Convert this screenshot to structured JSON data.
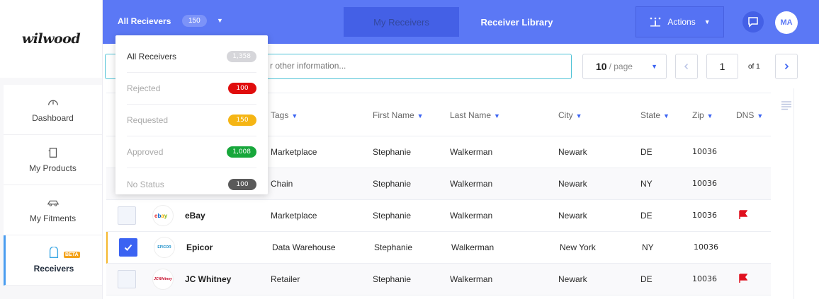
{
  "brand": {
    "logo_text": "wilwood"
  },
  "sidebar": {
    "items": [
      {
        "label": "Dashboard",
        "icon": "gauge-icon"
      },
      {
        "label": "My Products",
        "icon": "product-icon"
      },
      {
        "label": "My Fitments",
        "icon": "car-icon"
      },
      {
        "label": "Receivers",
        "icon": "receiver-icon",
        "badge": "BETA",
        "active": true
      }
    ]
  },
  "header": {
    "title": "All Recievers",
    "count": "150",
    "tabs": [
      {
        "label": "My Receivers",
        "active": false
      },
      {
        "label": "Receiver Library",
        "active": true
      }
    ],
    "actions_label": "Actions",
    "avatar_initials": "MA",
    "bg_color": "#5b78f5"
  },
  "dropdown": {
    "items": [
      {
        "label": "All Receivers",
        "count": "1,358",
        "color": "#d6d6da"
      },
      {
        "label": "Rejected",
        "count": "100",
        "color": "#e00d0d"
      },
      {
        "label": "Requested",
        "count": "150",
        "color": "#f5b514"
      },
      {
        "label": "Approved",
        "count": "1,008",
        "color": "#17a73b"
      },
      {
        "label": "No Status",
        "count": "100",
        "color": "#5a5a5a"
      }
    ]
  },
  "search": {
    "placeholder_visible": "r other information..."
  },
  "pagination": {
    "per_page": "10",
    "per_page_unit": "/ page",
    "current": "1",
    "of_label": "of 1"
  },
  "table": {
    "columns": [
      "Tags",
      "First Name",
      "Last Name",
      "City",
      "State",
      "Zip",
      "DNS"
    ],
    "rows": [
      {
        "name": "",
        "logo": "",
        "tags": "Marketplace",
        "first": "Stephanie",
        "last": "Walkerman",
        "city": "Newark",
        "state": "DE",
        "zip": "10036",
        "dns": false,
        "checked": false
      },
      {
        "name": "",
        "logo": "",
        "tags": "Chain",
        "first": "Stephanie",
        "last": "Walkerman",
        "city": "Newark",
        "state": "NY",
        "zip": "10036",
        "dns": false,
        "checked": false
      },
      {
        "name": "eBay",
        "logo": "ebay",
        "tags": "Marketplace",
        "first": "Stephanie",
        "last": "Walkerman",
        "city": "Newark",
        "state": "DE",
        "zip": "10036",
        "dns": true,
        "checked": false
      },
      {
        "name": "Epicor",
        "logo": "EPICOR",
        "tags": "Data Warehouse",
        "first": "Stephanie",
        "last": "Walkerman",
        "city": "New York",
        "state": "NY",
        "zip": "10036",
        "dns": false,
        "checked": true
      },
      {
        "name": "JC Whitney",
        "logo": "JCWhitney",
        "tags": "Retailer",
        "first": "Stephanie",
        "last": "Walkerman",
        "city": "Newark",
        "state": "DE",
        "zip": "10036",
        "dns": true,
        "checked": false
      }
    ]
  },
  "colors": {
    "accent": "#3b63f2",
    "flag": "#e0101e",
    "selected_row_marker": "#f5b82e"
  }
}
